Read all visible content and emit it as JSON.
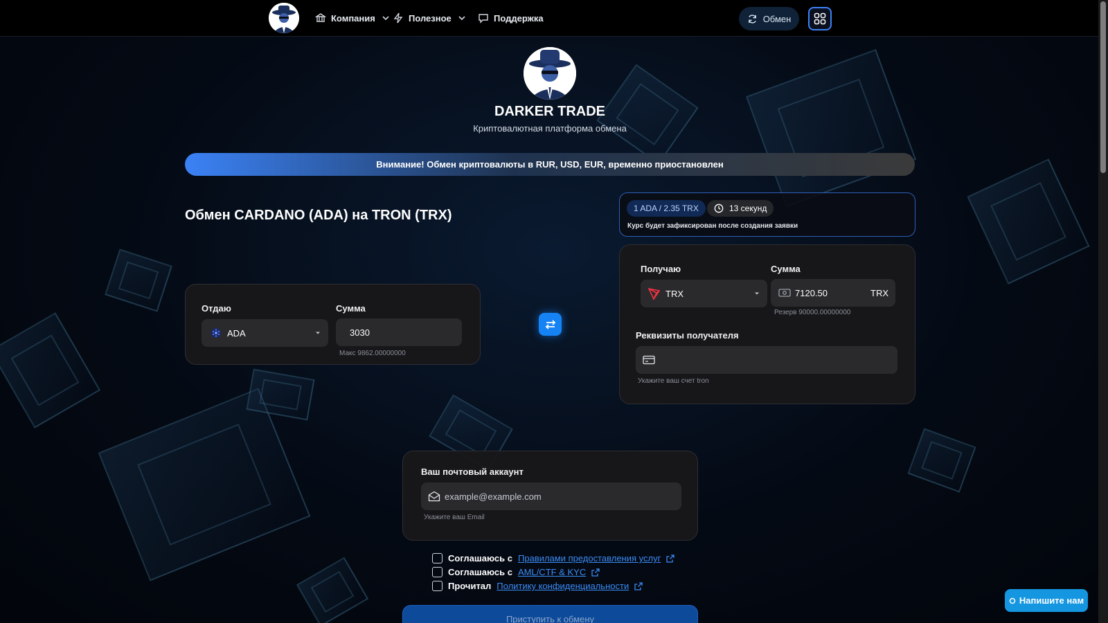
{
  "header": {
    "nav": [
      {
        "label": "Компания",
        "icon": "bank-icon"
      },
      {
        "label": "Полезное",
        "icon": "lightning-icon"
      },
      {
        "label": "Поддержка",
        "icon": "chat-icon"
      }
    ],
    "exchange_button": "Обмен"
  },
  "hero": {
    "brand": "DARKER TRADE",
    "tagline": "Криптовалютная платформа обмена"
  },
  "notice": "Внимание! Обмен криптовалюты в RUR, USD, EUR, временно приостановлен",
  "exchange": {
    "title": "Обмен CARDANO (ADA) на TRON (TRX)",
    "rate": "1 ADA / 2.35 TRX",
    "timer": "13 секунд",
    "rate_note": "Курс будет зафиксирован после создания заявки",
    "give": {
      "label": "Отдаю",
      "currency": "ADA",
      "amount_label": "Сумма",
      "amount": "3030",
      "hint": "Макс 9862.00000000"
    },
    "get": {
      "label": "Получаю",
      "currency": "TRX",
      "amount_label": "Сумма",
      "amount": "7120.50",
      "unit": "TRX",
      "hint": "Резерв 90000.00000000"
    },
    "recipient": {
      "label": "Реквизиты получателя",
      "value": "",
      "hint": "Укажите ваш счет tron"
    }
  },
  "email": {
    "label": "Ваш почтовый аккаунт",
    "placeholder": "example@example.com",
    "hint": "Укажите ваш Email"
  },
  "agreements": [
    {
      "prefix": "Соглашаюсь с",
      "link": "Правилами предоставления услуг"
    },
    {
      "prefix": "Соглашаюсь с",
      "link": "AML/CTF & KYC"
    },
    {
      "prefix": "Прочитал",
      "link": "Политику конфиденциальности"
    }
  ],
  "submit_label": "Приступить к обмену",
  "chat_label": "Напишите нам",
  "colors": {
    "accent": "#3b82f6",
    "link": "#3b8cf6",
    "chat": "#1596e0"
  }
}
